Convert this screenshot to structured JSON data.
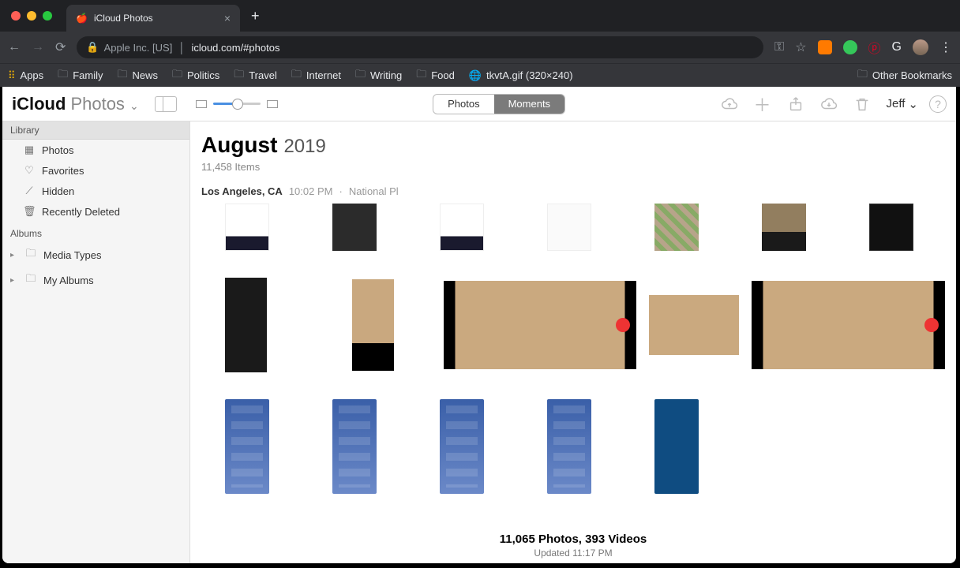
{
  "browser": {
    "tab_title": "iCloud Photos",
    "omnibox": {
      "authority": "Apple Inc. [US]",
      "url_display": "icloud.com/#photos"
    },
    "bookmarks": [
      "Apps",
      "Family",
      "News",
      "Politics",
      "Travel",
      "Internet",
      "Writing",
      "Food",
      "tkvtA.gif (320×240)"
    ],
    "other_bookmarks": "Other Bookmarks"
  },
  "app": {
    "brand1": "iCloud",
    "brand2": "Photos",
    "segmented": {
      "left": "Photos",
      "right": "Moments"
    },
    "user": "Jeff"
  },
  "sidebar": {
    "section_library": "Library",
    "library": [
      "Photos",
      "Favorites",
      "Hidden",
      "Recently Deleted"
    ],
    "section_albums": "Albums",
    "albums": [
      "Media Types",
      "My Albums"
    ]
  },
  "content": {
    "month": "August",
    "year": "2019",
    "item_count": "11,458 Items",
    "location": {
      "city": "Los Angeles, CA",
      "time": "10:02 PM",
      "separator": "·",
      "place": "National Pl"
    }
  },
  "footer": {
    "summary": "11,065 Photos, 393 Videos",
    "updated": "Updated 11:17 PM"
  }
}
